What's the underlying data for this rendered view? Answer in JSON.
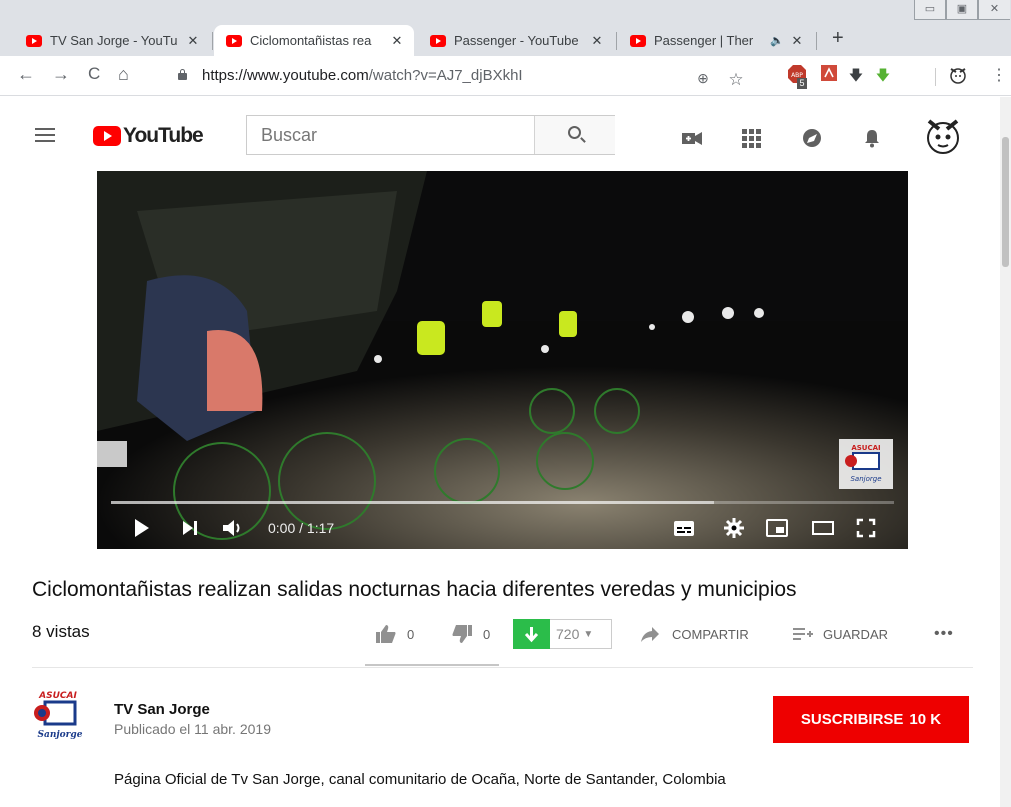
{
  "browser": {
    "tabs": [
      {
        "title": "TV San Jorge - YouTu",
        "active": false,
        "favicon": "youtube-icon"
      },
      {
        "title": "Ciclomontañistas rea",
        "active": true,
        "favicon": "youtube-icon"
      },
      {
        "title": "Passenger - YouTube",
        "active": false,
        "favicon": "youtube-icon"
      },
      {
        "title": "Passenger | Ther",
        "active": false,
        "favicon": "youtube-icon",
        "audio": "speaker-icon"
      }
    ],
    "new_tab": "+",
    "url": "https://www.youtube.com/watch?v=AJ7_djBXkhI",
    "url_host": "https://www.youtube.com",
    "url_path": "/watch?v=AJ7_djBXkhI",
    "adblock_badge": "5"
  },
  "masthead": {
    "logo_text": "YouTube",
    "search_placeholder": "Buscar"
  },
  "player": {
    "time": "0:00 / 1:17",
    "progress_buffered": 0.77,
    "watermark_text": "ASUCAI San Jorge"
  },
  "video": {
    "title": "Ciclomontañistas realizan salidas nocturnas hacia diferentes veredas y municipios",
    "views": "8 vistas",
    "likes": "0",
    "dislikes": "0",
    "download_count": "720",
    "share_label": "COMPARTIR",
    "save_label": "GUARDAR",
    "more_label": "•••"
  },
  "channel": {
    "name": "TV San Jorge",
    "published": "Publicado el 11 abr. 2019",
    "subscribe_label": "SUSCRIBIRSE",
    "subscriber_count": "10 K",
    "description": "Página Oficial de Tv San Jorge, canal comunitario de Ocaña, Norte de Santander, Colombia",
    "logo_text": "ASUCAI"
  },
  "colors": {
    "youtube_red": "#ff0000",
    "subscribe_red": "#ee0000",
    "download_green": "#2bbd4a"
  }
}
